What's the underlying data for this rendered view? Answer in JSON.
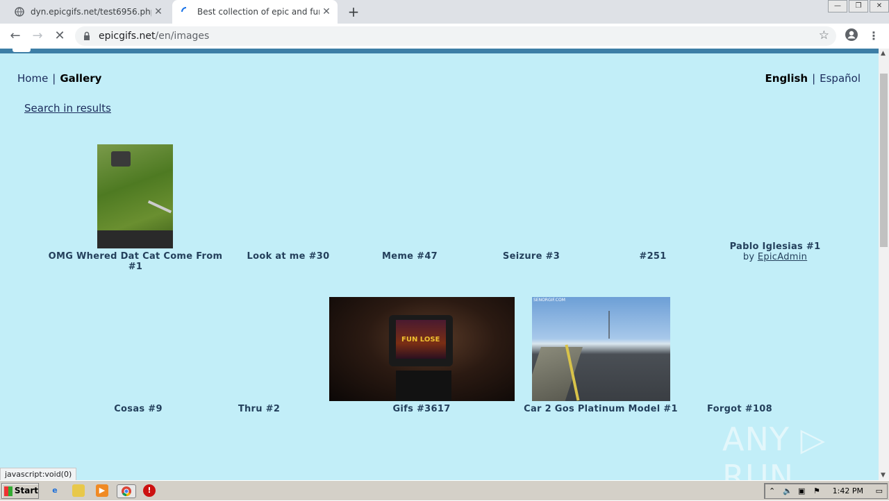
{
  "browser": {
    "tabs": [
      {
        "title": "dyn.epicgifs.net/test6956.php",
        "active": false
      },
      {
        "title": "Best collection of epic and funny gifs",
        "active": true
      }
    ],
    "url_host": "epicgifs.net",
    "url_path": "/en/images"
  },
  "page": {
    "nav": {
      "home": "Home",
      "separator": "|",
      "gallery": "Gallery"
    },
    "lang": {
      "english": "English",
      "separator": "|",
      "spanish": "Español"
    },
    "search_link": "Search in results",
    "row1": [
      {
        "title": "OMG Whered Dat Cat Come From #1"
      },
      {
        "title": "Look at me #30"
      },
      {
        "title": "Meme #47"
      },
      {
        "title": "Seizure #3"
      },
      {
        "title": "#251"
      },
      {
        "title": "Pablo Iglesias #1",
        "by_prefix": "by",
        "author": "EpicAdmin"
      }
    ],
    "row2": [
      {
        "title": "Cosas #9"
      },
      {
        "title": "Thru #2"
      },
      {
        "title": "Gifs #3617"
      },
      {
        "title": "Car 2 Gos Platinum Model #1"
      },
      {
        "title": "Forgot #108"
      }
    ],
    "thumb_texts": {
      "tv_screen": "FUN LOSE",
      "road_watermark": "SENORGIF.COM"
    }
  },
  "status_text": "javascript:void(0)",
  "watermark": "ANY ▷ RUN",
  "taskbar": {
    "start": "Start",
    "clock": "1:42 PM"
  },
  "colors": {
    "page_bg": "#c2eef8",
    "link": "#1a2a5a",
    "title": "#24405c"
  }
}
